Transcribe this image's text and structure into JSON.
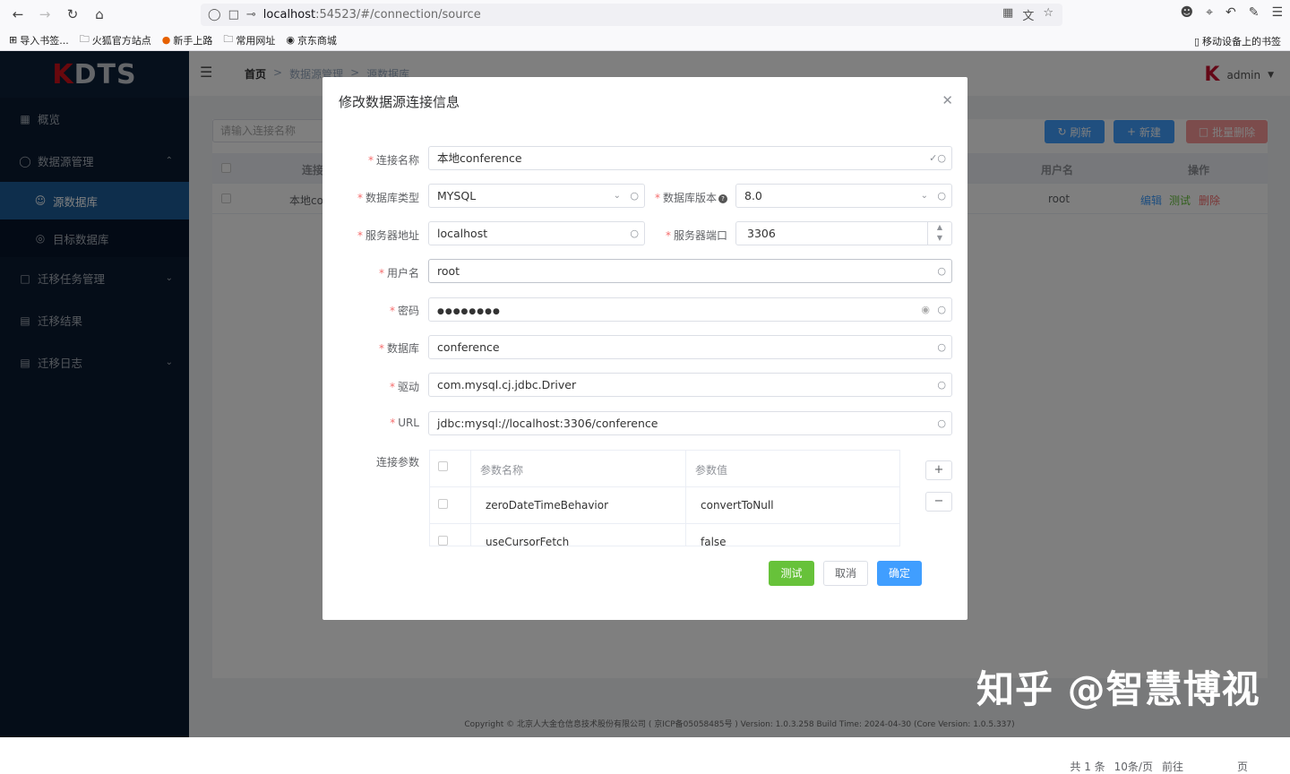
{
  "browser": {
    "url_host": "localhost",
    "url_path": ":54523/#/connection/source",
    "bookmarks": [
      "导入书签...",
      "火狐官方站点",
      "新手上路",
      "常用网址",
      "京东商城"
    ],
    "mobile_bookmarks": "移动设备上的书签"
  },
  "app": {
    "logo_k": "K",
    "logo_rest": "DTS",
    "sidebar": {
      "overview": "概览",
      "datasource_mgmt": "数据源管理",
      "source_db": "源数据库",
      "target_db": "目标数据库",
      "migration_task": "迁移任务管理",
      "migration_result": "迁移结果",
      "migration_log": "迁移日志"
    },
    "breadcrumb": [
      "首页",
      "数据源管理",
      "源数据库"
    ],
    "user": "admin",
    "search_placeholder": "请输入连接名称",
    "btn_refresh": "刷新",
    "btn_new": "新建",
    "btn_batch_delete": "批量删除",
    "table": {
      "col_conn": "连接",
      "col_user": "用户名",
      "col_ops": "操作",
      "row_name": "本地co",
      "row_user": "root",
      "op_edit": "编辑",
      "op_test": "测试",
      "op_delete": "删除"
    },
    "pager_total": "共 1 条",
    "pager_size": "10条/页",
    "pager_goto": "前往",
    "pager_page": "页",
    "footer": "Copyright © 北京人大金仓信息技术股份有限公司 ( 京ICP备05058485号 ) Version: 1.0.3.258 Build Time: 2024-04-30 (Core Version: 1.0.5.337)"
  },
  "dialog": {
    "title": "修改数据源连接信息",
    "labels": {
      "conn_name": "连接名称",
      "db_type": "数据库类型",
      "db_version": "数据库版本",
      "server_addr": "服务器地址",
      "server_port": "服务器端口",
      "username": "用户名",
      "password": "密码",
      "database": "数据库",
      "driver": "驱动",
      "url": "URL",
      "params": "连接参数"
    },
    "values": {
      "conn_name": "本地conference",
      "db_type": "MYSQL",
      "db_version": "8.0",
      "server_addr": "localhost",
      "server_port": "3306",
      "username": "root",
      "password": "●●●●●●●●",
      "database": "conference",
      "driver": "com.mysql.cj.jdbc.Driver",
      "url": "jdbc:mysql://localhost:3306/conference"
    },
    "param_table": {
      "col_name": "参数名称",
      "col_value": "参数值",
      "rows": [
        {
          "name": "zeroDateTimeBehavior",
          "value": "convertToNull"
        },
        {
          "name": "useCursorFetch",
          "value": "false"
        }
      ]
    },
    "btn_test": "测试",
    "btn_cancel": "取消",
    "btn_ok": "确定"
  },
  "watermark": "知乎 @智慧博视",
  "colors": {
    "sidebar_bg": "#0a1a30",
    "active_menu": "#1c5d99",
    "primary": "#409eff",
    "success": "#67c23a",
    "danger": "#f56c6c"
  }
}
